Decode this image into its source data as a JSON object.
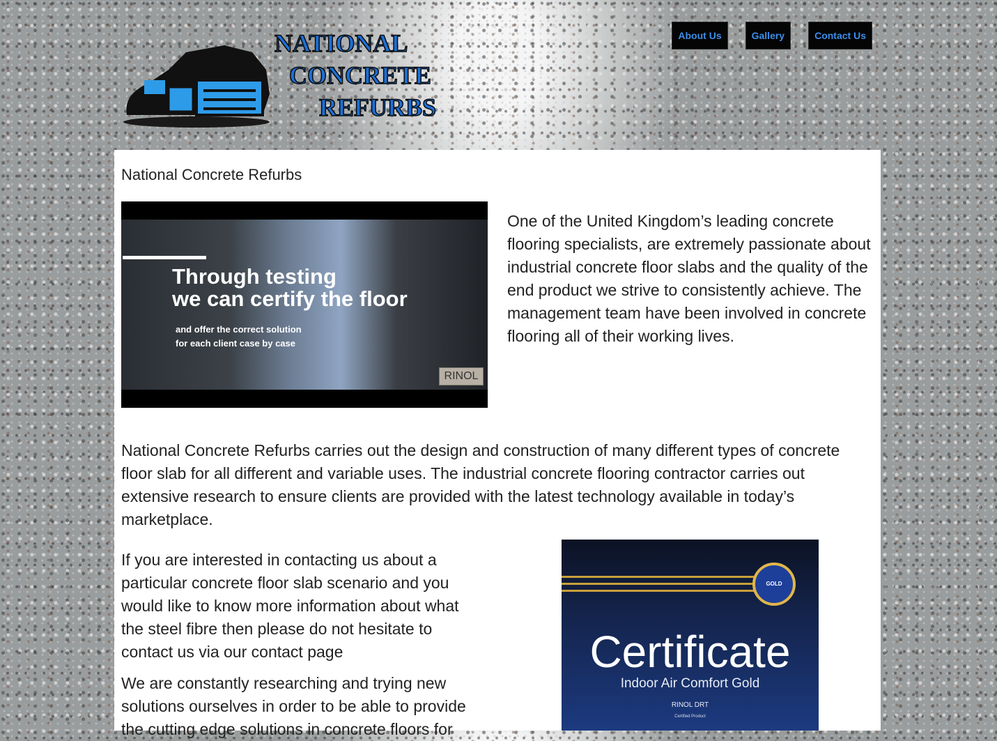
{
  "logo": {
    "line1": "NATIONAL",
    "line2": "CONCRETE",
    "line3": "REFURBS"
  },
  "nav": [
    {
      "label": "About Us"
    },
    {
      "label": "Gallery"
    },
    {
      "label": "Contact Us"
    }
  ],
  "page": {
    "title": "National Concrete Refurbs"
  },
  "video": {
    "headline1": "Through testing",
    "headline2": "we can certify the floor",
    "sub1": "and offer the correct solution",
    "sub2": "for each client case by case",
    "brand": "RINOL"
  },
  "content": {
    "intro": "One of the United Kingdom’s leading concrete flooring specialists, are extremely passionate about industrial concrete floor slabs and the quality of the end product we strive to consistently achieve. The management team have been involved in concrete flooring all of their working lives.",
    "para2": "National Concrete Refurbs carries out the design and construction of many different types of concrete floor slab for all different and variable uses. The industrial concrete flooring contractor carries out extensive research to ensure clients are provided with the latest technology available in today’s marketplace.",
    "para3": "If you are interested in contacting us about a particular concrete floor slab scenario and you would like to know more information about what the steel fibre then please do not hesitate to contact us via our contact page",
    "para4": "We are constantly researching and trying new solutions ourselves in order to be able to provide the cutting edge solutions in concrete floors for"
  },
  "certificate": {
    "seal": "GOLD",
    "title": "Certificate",
    "subtitle": "Indoor Air Comfort Gold",
    "product": "RINOL DRT",
    "tiny": "Certified Product"
  }
}
